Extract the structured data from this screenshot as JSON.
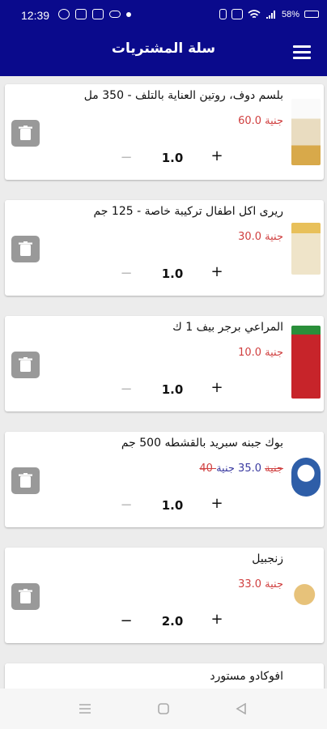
{
  "status_bar": {
    "time": "12:39",
    "battery": "58%",
    "icons": [
      "whatsapp-icon",
      "youtube-icon",
      "gallery-icon",
      "cloud-icon",
      "dot-icon",
      "vibrate-icon",
      "data-icon",
      "wifi-icon",
      "signal-icon",
      "battery-icon"
    ]
  },
  "header": {
    "title": "سلة المشتريات",
    "menu_icon": "hamburger-menu-icon",
    "background": "#0a0a8c"
  },
  "cart": {
    "items": [
      {
        "name": "بلسم دوف، روتين العناية بالتلف - 350 مل",
        "price": "60.0 جنية",
        "old_price": "",
        "quantity": "1.0",
        "minus_enabled": false,
        "thumb_color": "#f1e7d0"
      },
      {
        "name": "ريرى اكل اطفال تركيبة خاصة - 125 جم",
        "price": "30.0 جنية",
        "old_price": "",
        "quantity": "1.0",
        "minus_enabled": false,
        "thumb_color": "#e8d7b2"
      },
      {
        "name": "المراعي برجر بيف 1 ك",
        "price": "10.0 جنية",
        "old_price": "",
        "quantity": "1.0",
        "minus_enabled": false,
        "thumb_color": "#c7242a"
      },
      {
        "name": "بوك جبنه سبريد بالقشطه 500 جم",
        "price": "35.0 جنية",
        "old_price": "40 جنية",
        "quantity": "1.0",
        "minus_enabled": false,
        "thumb_color": "#2e5ea8"
      },
      {
        "name": "زنجبيل",
        "price": "33.0 جنية",
        "old_price": "",
        "quantity": "2.0",
        "minus_enabled": true,
        "thumb_color": "#e0c070"
      },
      {
        "name": "افوكادو مستورد",
        "price": "",
        "old_price": "",
        "quantity": "",
        "minus_enabled": false,
        "thumb_color": "#ffffff"
      }
    ],
    "minus_symbol": "−",
    "plus_symbol": "+",
    "delete_icon": "trash-icon"
  },
  "nav_bar": {
    "icons": [
      "recents-icon",
      "home-icon",
      "back-icon"
    ]
  }
}
